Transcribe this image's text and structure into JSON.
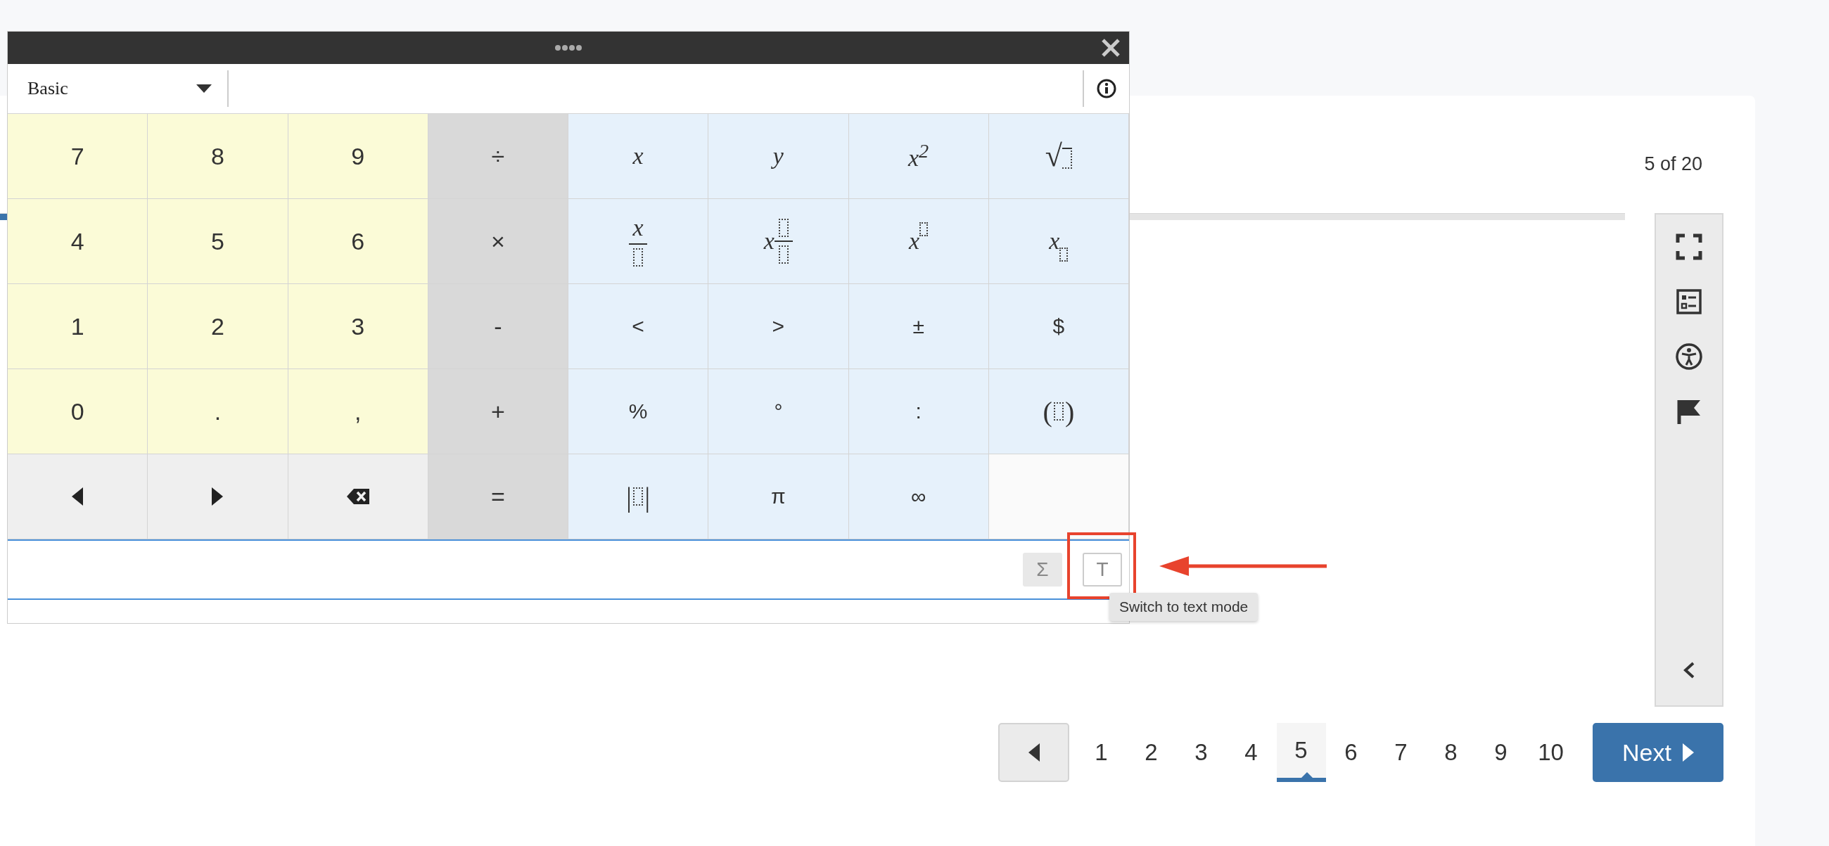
{
  "page": {
    "counter": "5 of 20",
    "progress": {
      "level": 0.25
    }
  },
  "calculator": {
    "mode": "Basic",
    "keys": [
      {
        "kind": "digit",
        "label": "7"
      },
      {
        "kind": "digit",
        "label": "8"
      },
      {
        "kind": "digit",
        "label": "9"
      },
      {
        "kind": "operator",
        "label": "÷"
      },
      {
        "kind": "math",
        "label": "x"
      },
      {
        "kind": "math",
        "label": "y"
      },
      {
        "kind": "math",
        "label": "*x*$^{2}$"
      },
      {
        "kind": "root",
        "label": "√"
      },
      {
        "kind": "digit",
        "label": "4"
      },
      {
        "kind": "digit",
        "label": "5"
      },
      {
        "kind": "digit",
        "label": "6"
      },
      {
        "kind": "operator",
        "label": "×"
      },
      {
        "kind": "fraction",
        "label": "x"
      },
      {
        "kind": "mixed",
        "label": "x"
      },
      {
        "kind": "power",
        "label": "x"
      },
      {
        "kind": "index",
        "label": "x"
      },
      {
        "kind": "digit",
        "label": "1"
      },
      {
        "kind": "digit",
        "label": "2"
      },
      {
        "kind": "digit",
        "label": "3"
      },
      {
        "kind": "operator",
        "label": "-"
      },
      {
        "kind": "symbol",
        "label": "<"
      },
      {
        "kind": "symbol",
        "label": ">"
      },
      {
        "kind": "symbol",
        "label": "±"
      },
      {
        "kind": "symbol",
        "label": "$"
      },
      {
        "kind": "digit",
        "label": "0"
      },
      {
        "kind": "digit",
        "label": "."
      },
      {
        "kind": "digit",
        "label": ","
      },
      {
        "kind": "operator",
        "label": "+"
      },
      {
        "kind": "symbol",
        "label": "%"
      },
      {
        "kind": "symbol",
        "label": "°"
      },
      {
        "kind": "symbol",
        "label": ":"
      },
      {
        "kind": "wrap",
        "label": "(",
        "close": ")"
      },
      {
        "kind": "left"
      },
      {
        "kind": "right"
      },
      {
        "kind": "delete"
      },
      {
        "kind": "operator",
        "label": "="
      },
      {
        "kind": "wrap",
        "label": "|",
        "close": "|"
      },
      {
        "kind": "symbol",
        "label": "π"
      },
      {
        "kind": "symbol",
        "label": "∞"
      },
      {
        "kind": "blank"
      }
    ],
    "mode_buttons": [
      {
        "label": "Σ",
        "selected": true
      },
      {
        "label": "T",
        "selected": false
      }
    ],
    "tooltip": "Switch to text mode"
  },
  "pagination": {
    "pages": [
      {
        "label": "1",
        "selected": false
      },
      {
        "label": "2",
        "selected": false
      },
      {
        "label": "3",
        "selected": false
      },
      {
        "label": "4",
        "selected": false
      },
      {
        "label": "5",
        "selected": true
      },
      {
        "label": "6",
        "selected": false
      },
      {
        "label": "7",
        "selected": false
      },
      {
        "label": "8",
        "selected": false
      },
      {
        "label": "9",
        "selected": false
      },
      {
        "label": "10",
        "selected": false
      }
    ],
    "next": "Next"
  }
}
